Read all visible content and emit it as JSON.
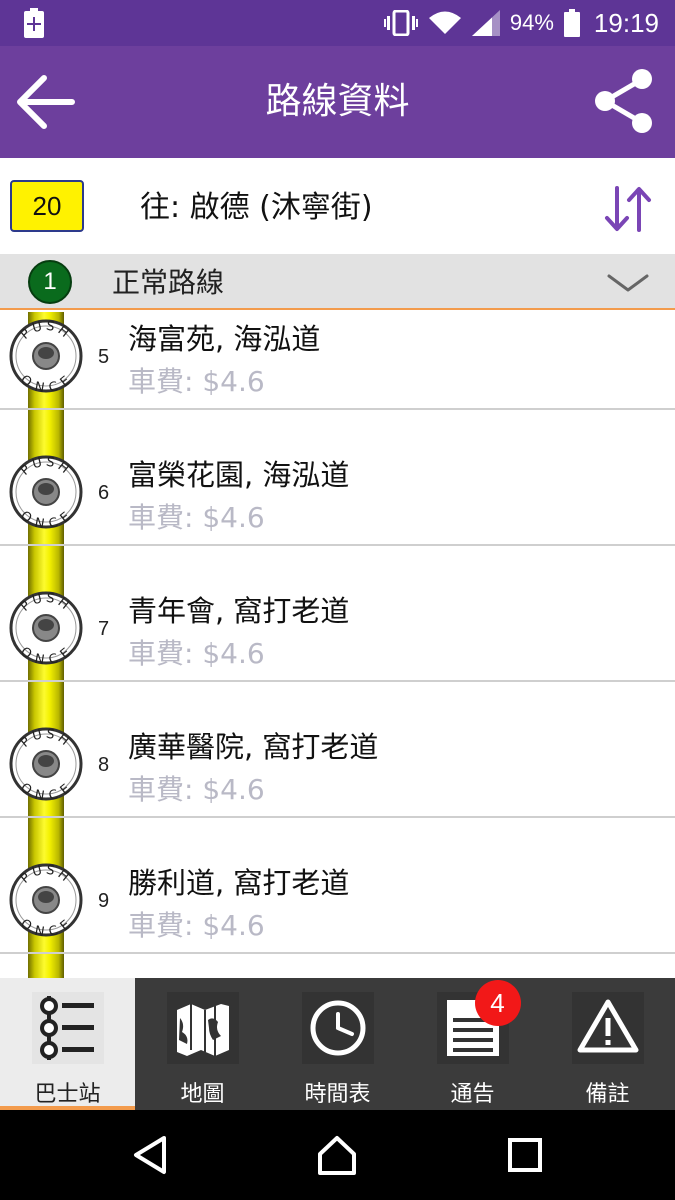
{
  "status": {
    "battery_percent": "94%",
    "time": "19:19"
  },
  "app_bar": {
    "title": "路線資料"
  },
  "route": {
    "number": "20",
    "destination": "往:  啟德 (沐寧街)"
  },
  "route_selector": {
    "index": "1",
    "label": "正常路線"
  },
  "stops": [
    {
      "seq": "5",
      "name": "海富苑, 海泓道",
      "fare": "車費: $4.6"
    },
    {
      "seq": "6",
      "name": "富榮花園, 海泓道",
      "fare": "車費: $4.6"
    },
    {
      "seq": "7",
      "name": "青年會, 窩打老道",
      "fare": "車費: $4.6"
    },
    {
      "seq": "8",
      "name": "廣華醫院, 窩打老道",
      "fare": "車費: $4.6"
    },
    {
      "seq": "9",
      "name": "勝利道, 窩打老道",
      "fare": "車費: $4.6"
    }
  ],
  "push_button_text": "PUSH ONCE",
  "bottom_nav": [
    {
      "label": "巴士站",
      "icon": "bus-stop-list-icon"
    },
    {
      "label": "地圖",
      "icon": "map-icon"
    },
    {
      "label": "時間表",
      "icon": "clock-icon"
    },
    {
      "label": "通告",
      "icon": "notice-document-icon",
      "badge": "4"
    },
    {
      "label": "備註",
      "icon": "warning-icon"
    }
  ],
  "colors": {
    "status_bar": "#5e3596",
    "app_bar": "#6d3f9d",
    "accent": "#f39b4c",
    "route_badge": "#fff200"
  }
}
